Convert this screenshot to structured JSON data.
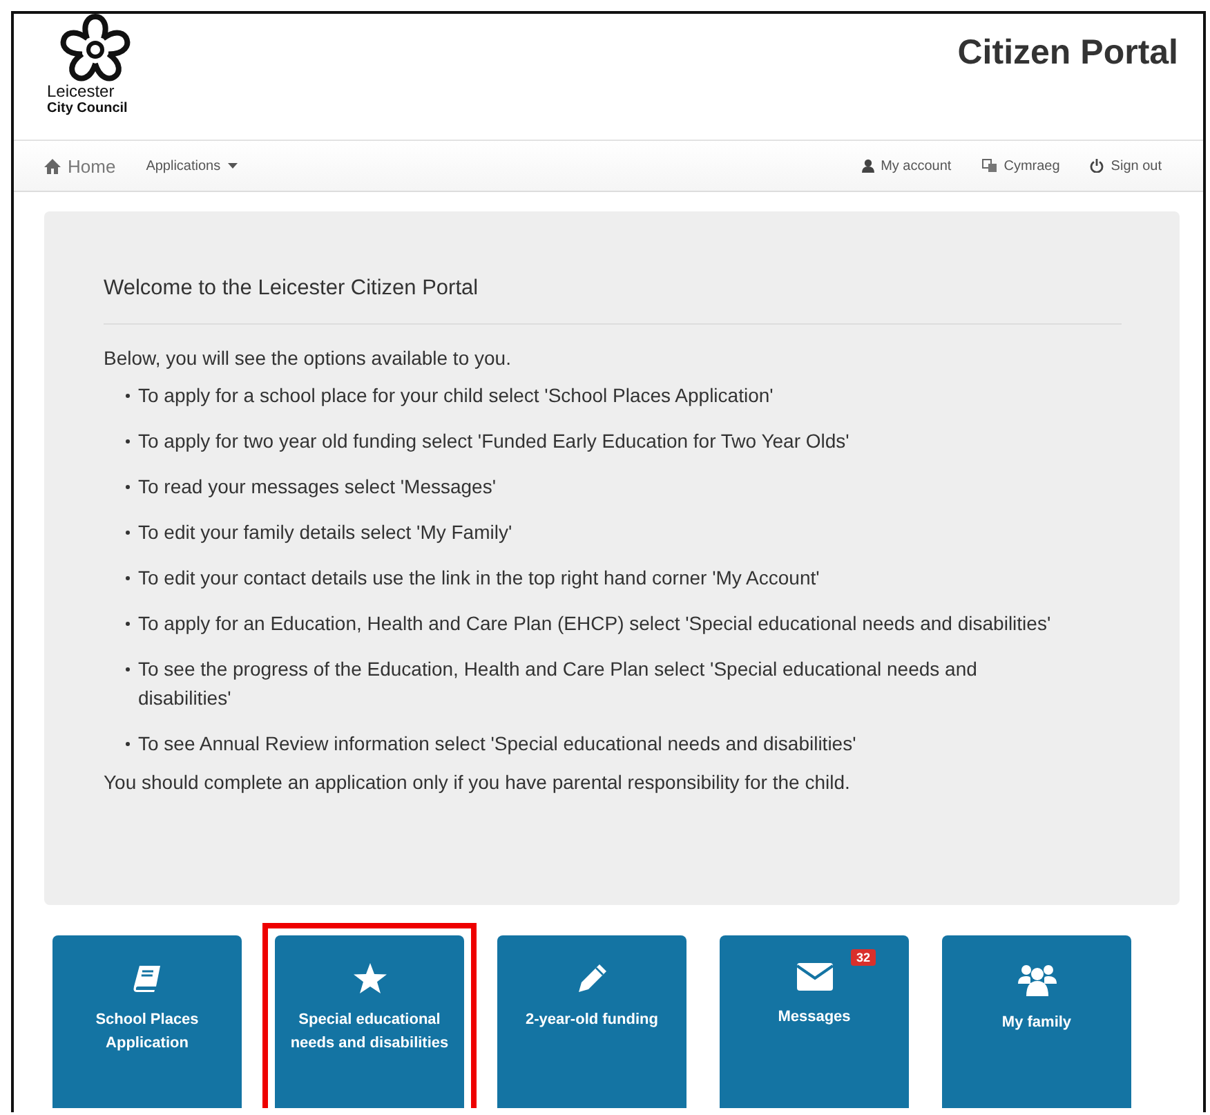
{
  "header": {
    "logo_line1": "Leicester",
    "logo_line2": "City Council",
    "title": "Citizen Portal"
  },
  "nav": {
    "left": [
      {
        "label": "Home",
        "dropdown": false
      },
      {
        "label": "Applications",
        "dropdown": true
      }
    ],
    "right": [
      {
        "label": "My account"
      },
      {
        "label": "Cymraeg"
      },
      {
        "label": "Sign out"
      }
    ]
  },
  "welcome": {
    "heading": "Welcome to the Leicester Citizen Portal",
    "intro": "Below, you will see the options available to you.",
    "bullets": [
      "To apply for a school place for your child select 'School Places Application'",
      "To apply for two year old funding select 'Funded Early Education for Two Year Olds'",
      "To read your messages select 'Messages'",
      "To edit your family details select 'My Family'",
      "To edit your contact details use the link in the top right hand corner 'My Account'",
      "To apply for an Education, Health and Care Plan (EHCP) select 'Special educational needs and disabilities'",
      "To see the progress of the Education, Health and Care Plan select 'Special educational needs and disabilities'",
      "To see Annual Review information select 'Special educational needs and disabilities'"
    ],
    "note": "You should complete an application only if you have parental responsibility for the child."
  },
  "tiles": [
    {
      "label": "School Places Application",
      "kind": "book",
      "highlighted": false
    },
    {
      "label": "Special educational needs and disabilities",
      "kind": "star",
      "highlighted": true
    },
    {
      "label": "2-year-old funding",
      "kind": "pencil",
      "highlighted": false
    },
    {
      "label": "Messages",
      "kind": "envelope",
      "highlighted": false,
      "badge": "32"
    },
    {
      "label": "My family",
      "kind": "people",
      "highlighted": false
    }
  ]
}
